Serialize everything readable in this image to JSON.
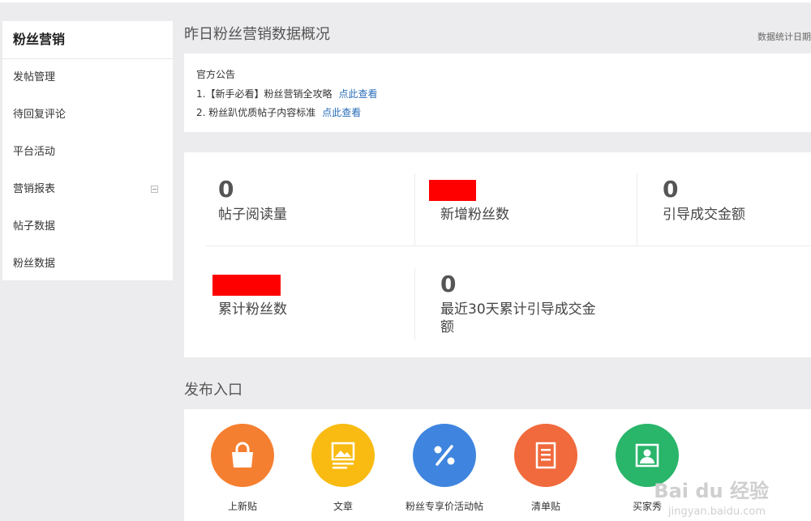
{
  "sidebar": {
    "title": "粉丝营销",
    "items": [
      {
        "label": "发帖管理"
      },
      {
        "label": "待回复评论"
      },
      {
        "label": "平台活动"
      },
      {
        "label": "营销报表"
      },
      {
        "label": "帖子数据"
      },
      {
        "label": "粉丝数据"
      }
    ]
  },
  "overview": {
    "title": "昨日粉丝营销数据概况",
    "stat_date_label": "数据统计日期"
  },
  "notice": {
    "heading": "官方公告",
    "items": [
      {
        "text": "1.【新手必看】粉丝营销全攻略",
        "link": "点此查看"
      },
      {
        "text": "2. 粉丝趴优质帖子内容标准",
        "link": "点此查看"
      }
    ]
  },
  "stats": {
    "post_reads": {
      "value": "0",
      "label": "帖子阅读量"
    },
    "new_fans": {
      "label": "新增粉丝数"
    },
    "guided_amount": {
      "value": "0",
      "label": "引导成交金额"
    },
    "total_fans": {
      "label": "累计粉丝数"
    },
    "guided_30d": {
      "value": "0",
      "label_line1": "最近30天累计引导成交金",
      "label_line2": "额"
    }
  },
  "publish": {
    "title": "发布入口",
    "items": [
      {
        "label": "上新贴",
        "color": "#f57f30",
        "icon": "shopping-bag-icon"
      },
      {
        "label": "文章",
        "color": "#f9bb12",
        "icon": "image-article-icon"
      },
      {
        "label": "粉丝专享价活动帖",
        "color": "#3f85df",
        "icon": "percent-icon"
      },
      {
        "label": "清单贴",
        "color": "#f06a3d",
        "icon": "list-document-icon"
      },
      {
        "label": "买家秀",
        "color": "#29b56a",
        "icon": "photo-show-icon"
      }
    ]
  },
  "watermark": {
    "brand": "Bai du 经验",
    "url": "jingyan.baidu.com"
  },
  "colors": {
    "link": "#2a6eb8",
    "redaction": "#ff0000",
    "background": "#ececee"
  }
}
